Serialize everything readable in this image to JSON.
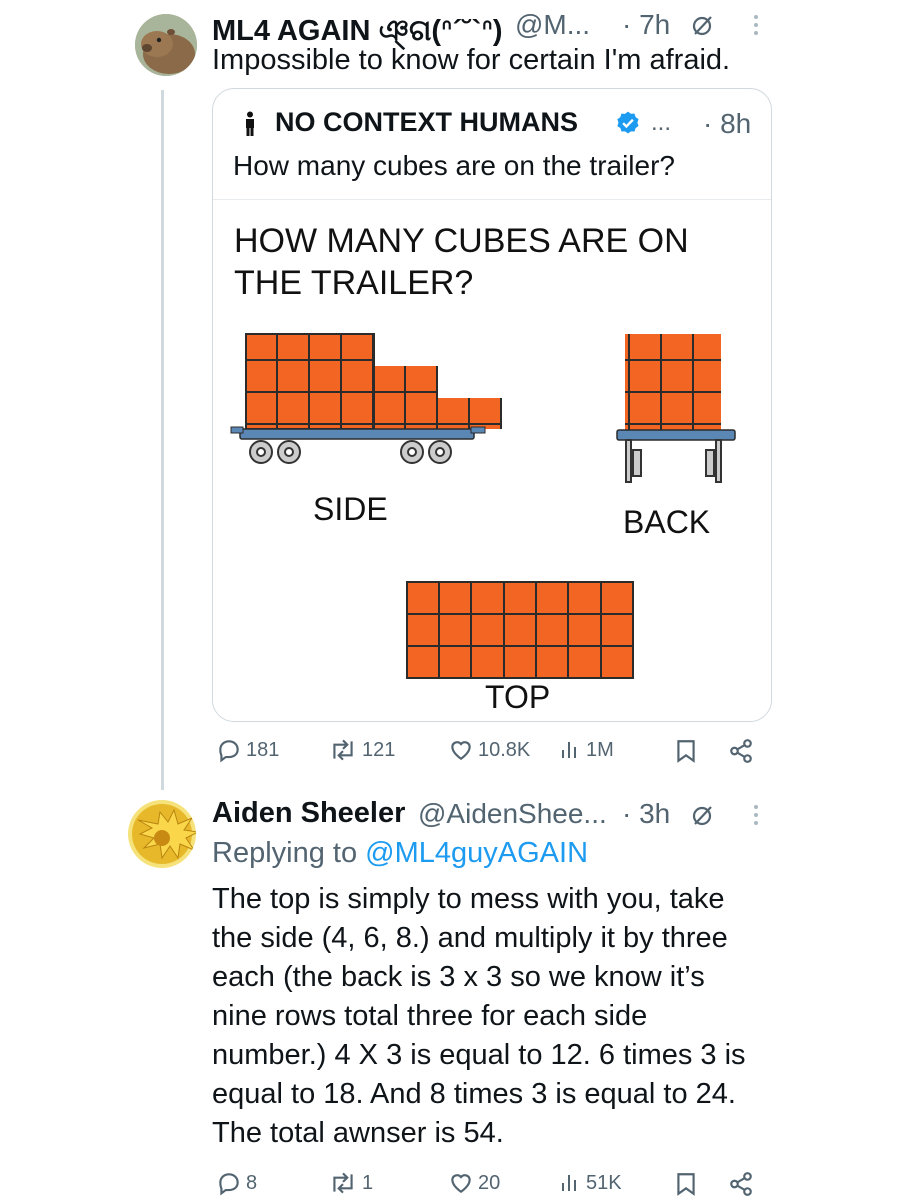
{
  "tweet1": {
    "name": "ML4 AGAIN ঞ্ଗ(ᐢ´˘`ᐢ)",
    "handle": "@M...",
    "time": "· 7h",
    "text": "Impossible to know for certain I'm afraid.",
    "quote": {
      "name": "NO CONTEXT HUMANS",
      "dots": "...",
      "time": "· 8h",
      "text": "How many cubes are on the trailer?",
      "image": {
        "title_line1": "HOW MANY CUBES ARE ON",
        "title_line2": "THE TRAILER?",
        "label_side": "SIDE",
        "label_back": "BACK",
        "label_top": "TOP",
        "cube_color": "#f26522",
        "trailer_color": "#5b87b5"
      }
    },
    "actions": {
      "replies": "181",
      "reposts": "121",
      "likes": "10.8K",
      "views": "1M"
    }
  },
  "tweet2": {
    "name": "Aiden Sheeler",
    "handle": "@AidenShee...",
    "time": "· 3h",
    "replying_prefix": "Replying to ",
    "replying_to": "@ML4guyAGAIN",
    "lines": [
      "The top is simply to mess with you, take",
      "the side (4, 6, 8.) and multiply it by three",
      "each (the back is 3 x 3 so we know it’s",
      "nine rows total three for each side",
      "number.) 4 X 3 is equal to 12. 6 times 3 is",
      "equal to 18. And 8 times 3 is equal to 24.",
      "The total awnser is 54."
    ],
    "actions": {
      "replies": "8",
      "reposts": "1",
      "likes": "20",
      "views": "51K"
    }
  },
  "colors": {
    "accent": "#1d9bf0",
    "muted": "#536471",
    "border": "#cfd9de"
  }
}
